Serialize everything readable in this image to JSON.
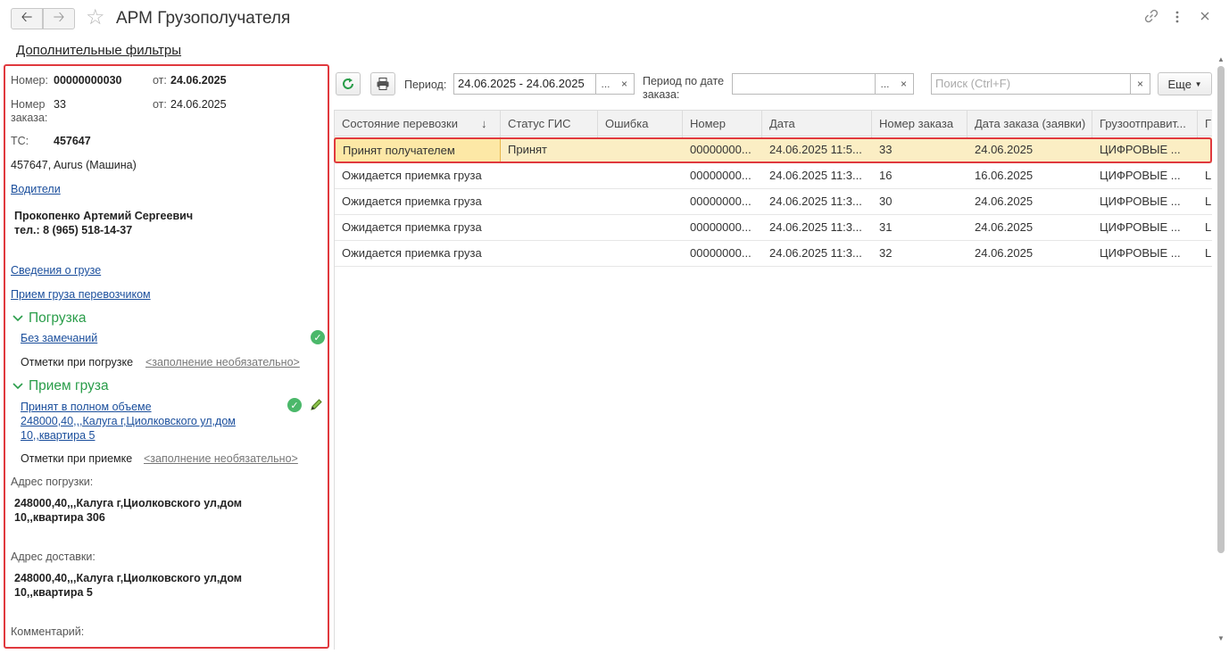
{
  "window": {
    "title": "АРМ Грузополучателя",
    "back_icon": "arrow-left-icon",
    "forward_icon": "arrow-right-icon",
    "favorite_icon": "star-icon"
  },
  "extra_filters_link": "Дополнительные фильтры",
  "left_panel": {
    "number_label": "Номер:",
    "number_value": "00000000030",
    "from_label_1": "от:",
    "date_1": "24.06.2025",
    "order_number_label": "Номер заказа:",
    "order_number_value": "33",
    "from_label_2": "от:",
    "date_2": "24.06.2025",
    "ts_label": "ТС:",
    "ts_value": "457647",
    "vehicle": "457647, Aurus (Машина)",
    "drivers_link": "Водители",
    "driver_name": "Прокопенко Артемий Сергеевич",
    "driver_phone": "тел.: 8 (965) 518-14-37",
    "cargo_info_link": "Сведения о грузе",
    "carrier_accept_link": "Прием груза перевозчиком",
    "loading": {
      "title": "Погрузка",
      "status_link": "Без замечаний",
      "notes_label": "Отметки при погрузке",
      "notes_link": "<заполнение необязательно>"
    },
    "receiving": {
      "title": "Прием груза",
      "status_link_line1": "Принят в полном объеме",
      "status_link_line2": "248000,40,,,Калуга г,Циолковского ул,дом",
      "status_link_line3": "10,,квартира 5",
      "notes_label": "Отметки при приемке",
      "notes_link": "<заполнение необязательно>"
    },
    "loading_address_label": "Адрес погрузки:",
    "loading_address_line1": "248000,40,,,Калуга г,Циолковского ул,дом",
    "loading_address_line2": "10,,квартира 306",
    "delivery_address_label": "Адрес доставки:",
    "delivery_address_line1": "248000,40,,,Калуга г,Циолковского ул,дом",
    "delivery_address_line2": "10,,квартира 5",
    "comment_label": "Комментарий:"
  },
  "toolbar": {
    "period_label": "Период:",
    "period_value": "24.06.2025 - 24.06.2025",
    "period_by_order_label_1": "Период по дате",
    "period_by_order_label_2": "заказа:",
    "period_by_order_value": "",
    "search_placeholder": "Поиск (Ctrl+F)",
    "more_button": "Еще",
    "ellipsis": "...",
    "clear": "×"
  },
  "table": {
    "columns": [
      "Состояние перевозки",
      "Статус ГИС",
      "Ошибка",
      "Номер",
      "Дата",
      "Номер заказа",
      "Дата заказа (заявки)",
      "Грузоотправит...",
      "Г"
    ],
    "rows": [
      [
        "Принят получателем",
        "Принят",
        "",
        "00000000...",
        "24.06.2025 11:5...",
        "33",
        "24.06.2025",
        "ЦИФРОВЫЕ ...",
        ""
      ],
      [
        "Ожидается приемка груза",
        "",
        "",
        "00000000...",
        "24.06.2025 11:3...",
        "16",
        "16.06.2025",
        "ЦИФРОВЫЕ ...",
        "L"
      ],
      [
        "Ожидается приемка груза",
        "",
        "",
        "00000000...",
        "24.06.2025 11:3...",
        "30",
        "24.06.2025",
        "ЦИФРОВЫЕ ...",
        "L"
      ],
      [
        "Ожидается приемка груза",
        "",
        "",
        "00000000...",
        "24.06.2025 11:3...",
        "31",
        "24.06.2025",
        "ЦИФРОВЫЕ ...",
        "L"
      ],
      [
        "Ожидается приемка груза",
        "",
        "",
        "00000000...",
        "24.06.2025 11:3...",
        "32",
        "24.06.2025",
        "ЦИФРОВЫЕ ...",
        "L"
      ]
    ],
    "selected_row": 0
  },
  "colors": {
    "accent_green": "#2a9d4a",
    "highlight_red": "#e0393e",
    "selected_row": "#fbeec4",
    "link": "#1a4e9c"
  }
}
